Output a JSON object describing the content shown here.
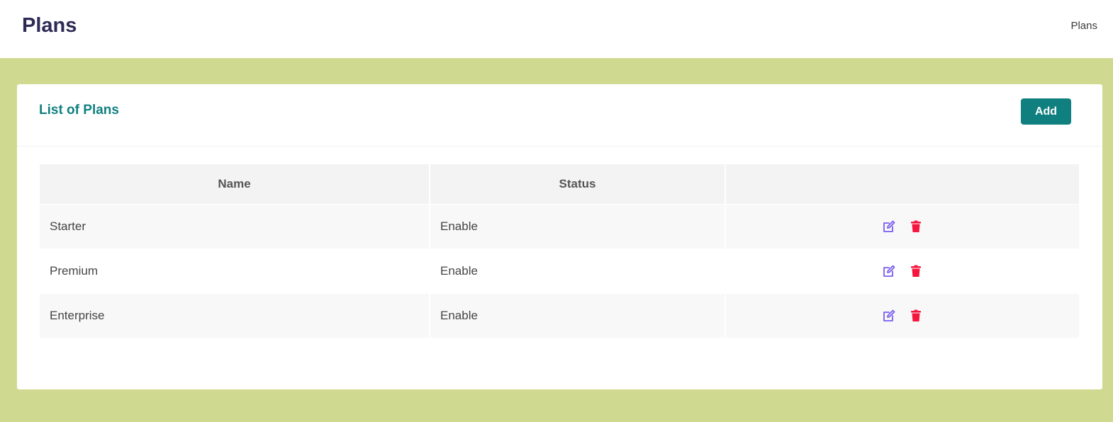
{
  "header": {
    "title": "Plans",
    "breadcrumb": "Plans"
  },
  "card": {
    "title": "List of Plans",
    "add_label": "Add"
  },
  "table": {
    "columns": [
      "Name",
      "Status",
      ""
    ],
    "rows": [
      {
        "name": "Starter",
        "status": "Enable"
      },
      {
        "name": "Premium",
        "status": "Enable"
      },
      {
        "name": "Enterprise",
        "status": "Enable"
      }
    ]
  },
  "icons": {
    "edit": "edit-icon",
    "delete": "trash-icon"
  },
  "colors": {
    "accent": "#0f7f7f",
    "status_enabled": "#1ccf6a",
    "edit_icon": "#7b5cf0",
    "delete_icon": "#f5163e",
    "background": "#d0d990"
  }
}
